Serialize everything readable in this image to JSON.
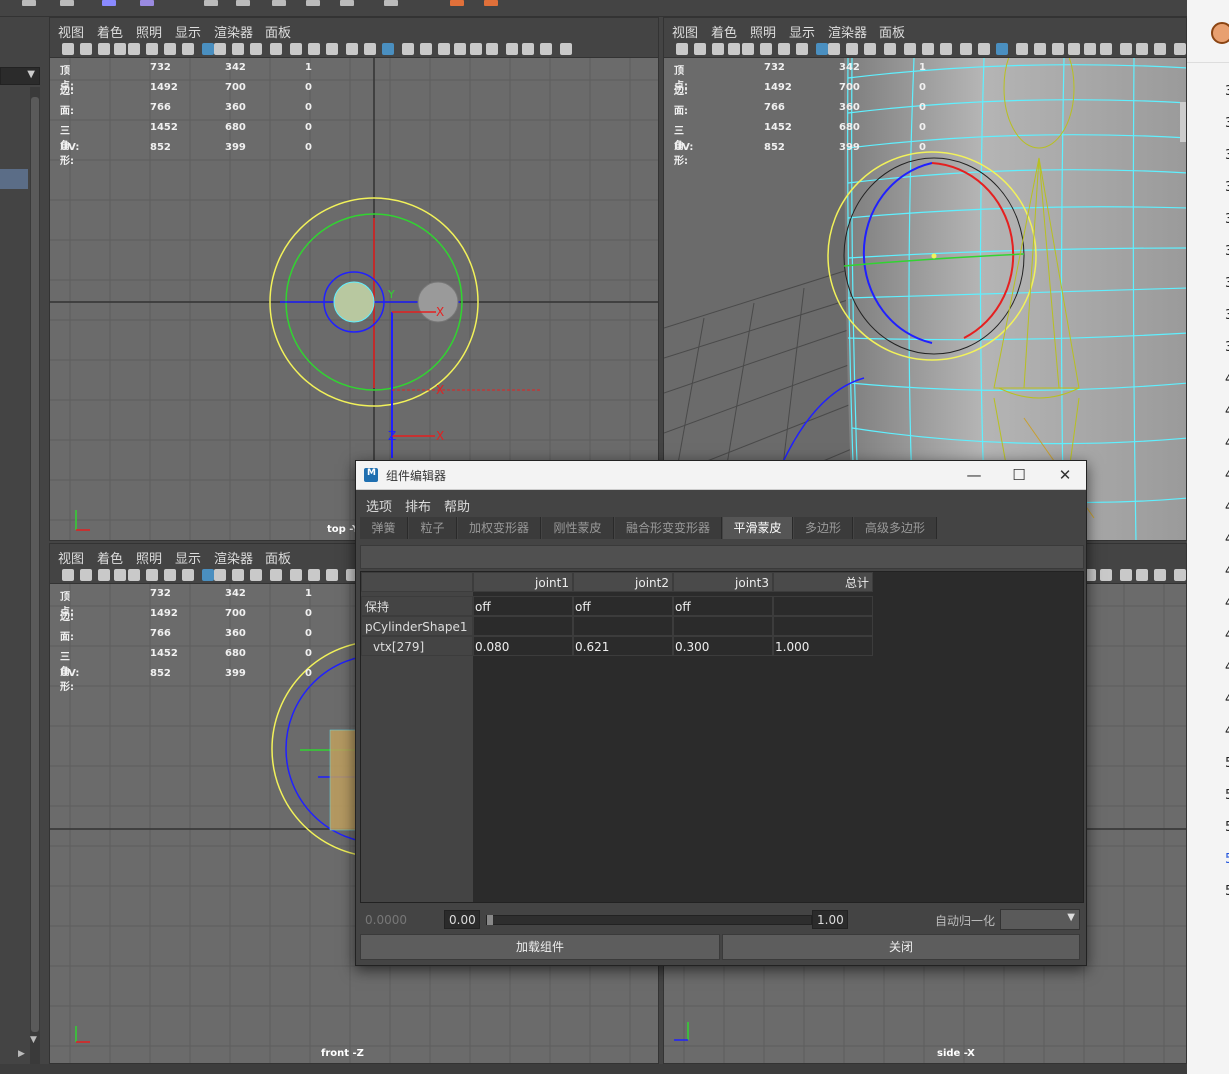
{
  "viewport_menu": [
    "视图",
    "着色",
    "照明",
    "显示",
    "渲染器",
    "面板"
  ],
  "hud": {
    "rows": [
      {
        "label": "顶点:",
        "v1": "732",
        "v2": "342",
        "v3": "1"
      },
      {
        "label": "边:",
        "v1": "1492",
        "v2": "700",
        "v3": "0"
      },
      {
        "label": "面:",
        "v1": "766",
        "v2": "360",
        "v3": "0"
      },
      {
        "label": "三角形:",
        "v1": "1452",
        "v2": "680",
        "v3": "0"
      },
      {
        "label": "UV:",
        "v1": "852",
        "v2": "399",
        "v3": "0"
      }
    ]
  },
  "viewports": {
    "top": {
      "label": "top -Y"
    },
    "front": {
      "label": "front -Z"
    },
    "side": {
      "label": "side -X"
    }
  },
  "gizmo_labels": {
    "x": "X",
    "y": "Y",
    "z": "Z"
  },
  "dialog": {
    "title": "组件编辑器",
    "window_buttons": {
      "minimize": "—",
      "maximize": "☐",
      "close": "✕"
    },
    "menu": [
      "选项",
      "排布",
      "帮助"
    ],
    "tabs": [
      "弹簧",
      "粒子",
      "加权变形器",
      "刚性蒙皮",
      "融合形变变形器",
      "平滑蒙皮",
      "多边形",
      "高级多边形"
    ],
    "active_tab": "平滑蒙皮",
    "table": {
      "columns": [
        "joint1",
        "joint2",
        "joint3",
        "总计"
      ],
      "rows": [
        {
          "label": "保持",
          "values": [
            "off",
            "off",
            "off",
            ""
          ]
        },
        {
          "label": "pCylinderShape1",
          "values": [
            "",
            "",
            "",
            ""
          ]
        },
        {
          "label": "vtx[279]",
          "values": [
            "0.080",
            "0.621",
            "0.300",
            "1.000"
          ]
        }
      ]
    },
    "slider": {
      "current_value": "0.0000",
      "min": "0.00",
      "max": "1.00",
      "auto_normalize_label": "自动归一化"
    },
    "buttons": {
      "load": "加载组件",
      "close": "关闭"
    }
  },
  "right_panel_numbers": [
    "3",
    "3",
    "3",
    "3",
    "3",
    "3",
    "3",
    "3",
    "3",
    "4",
    "4",
    "4",
    "4",
    "4",
    "4",
    "4",
    "4",
    "4",
    "4",
    "4",
    "4",
    "5",
    "5",
    "5",
    "5",
    "5"
  ],
  "right_panel_highlight_index": 24,
  "colors": {
    "viewport_bg": "#6b6b6b",
    "wire_cyan": "#5ff0ff",
    "circle_yellow": "#f2f25a",
    "circle_green": "#31d431",
    "joint_blue": "#2020ff",
    "axis_red": "#e52020",
    "accent_blue": "#4a8fc0"
  }
}
